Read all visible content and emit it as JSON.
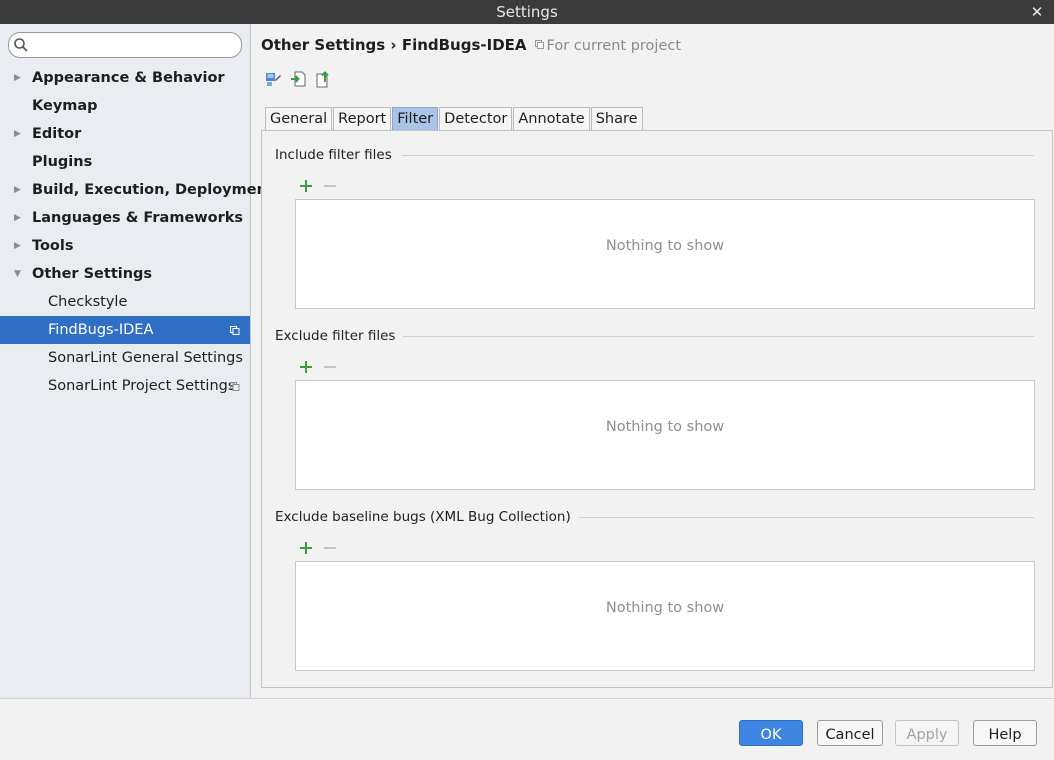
{
  "window": {
    "title": "Settings",
    "close_glyph": "✕"
  },
  "search": {
    "value": "",
    "placeholder": ""
  },
  "sidebar": {
    "items": [
      {
        "label": "Appearance & Behavior",
        "level": "top",
        "arrow": "▶"
      },
      {
        "label": "Keymap",
        "level": "top",
        "arrow": ""
      },
      {
        "label": "Editor",
        "level": "top",
        "arrow": "▶"
      },
      {
        "label": "Plugins",
        "level": "top",
        "arrow": ""
      },
      {
        "label": "Build, Execution, Deployment",
        "level": "top",
        "arrow": "▶"
      },
      {
        "label": "Languages & Frameworks",
        "level": "top",
        "arrow": "▶"
      },
      {
        "label": "Tools",
        "level": "top",
        "arrow": "▶"
      },
      {
        "label": "Other Settings",
        "level": "top",
        "arrow": "▼"
      },
      {
        "label": "Checkstyle",
        "level": "child"
      },
      {
        "label": "FindBugs-IDEA",
        "level": "child",
        "selected": true,
        "project_icon": true
      },
      {
        "label": "SonarLint General Settings",
        "level": "child"
      },
      {
        "label": "SonarLint Project Settings",
        "level": "child",
        "project_icon": true
      }
    ]
  },
  "header": {
    "breadcrumb": "Other Settings › FindBugs-IDEA",
    "scope_note": "For current project"
  },
  "toolbar": {
    "icons": [
      "import-settings-icon",
      "import-file-icon",
      "export-file-icon"
    ]
  },
  "tabs": [
    {
      "label": "General"
    },
    {
      "label": "Report"
    },
    {
      "label": "Filter",
      "active": true
    },
    {
      "label": "Detector"
    },
    {
      "label": "Annotate"
    },
    {
      "label": "Share"
    }
  ],
  "filter": {
    "include": {
      "title": "Include filter files",
      "empty_text": "Nothing to show"
    },
    "exclude": {
      "title": "Exclude filter files",
      "empty_text": "Nothing to show"
    },
    "baseline": {
      "title": "Exclude baseline bugs (XML Bug Collection)",
      "empty_text": "Nothing to show"
    },
    "add_glyph": "+",
    "remove_glyph": "−"
  },
  "footer": {
    "ok_label": "OK",
    "cancel_label": "Cancel",
    "apply_label": "Apply",
    "help_label": "Help"
  },
  "colors": {
    "accent": "#2f6fc6",
    "primary_button": "#3f86e3",
    "add_green": "#3c9b3c",
    "active_tab": "#a9c4e6"
  }
}
